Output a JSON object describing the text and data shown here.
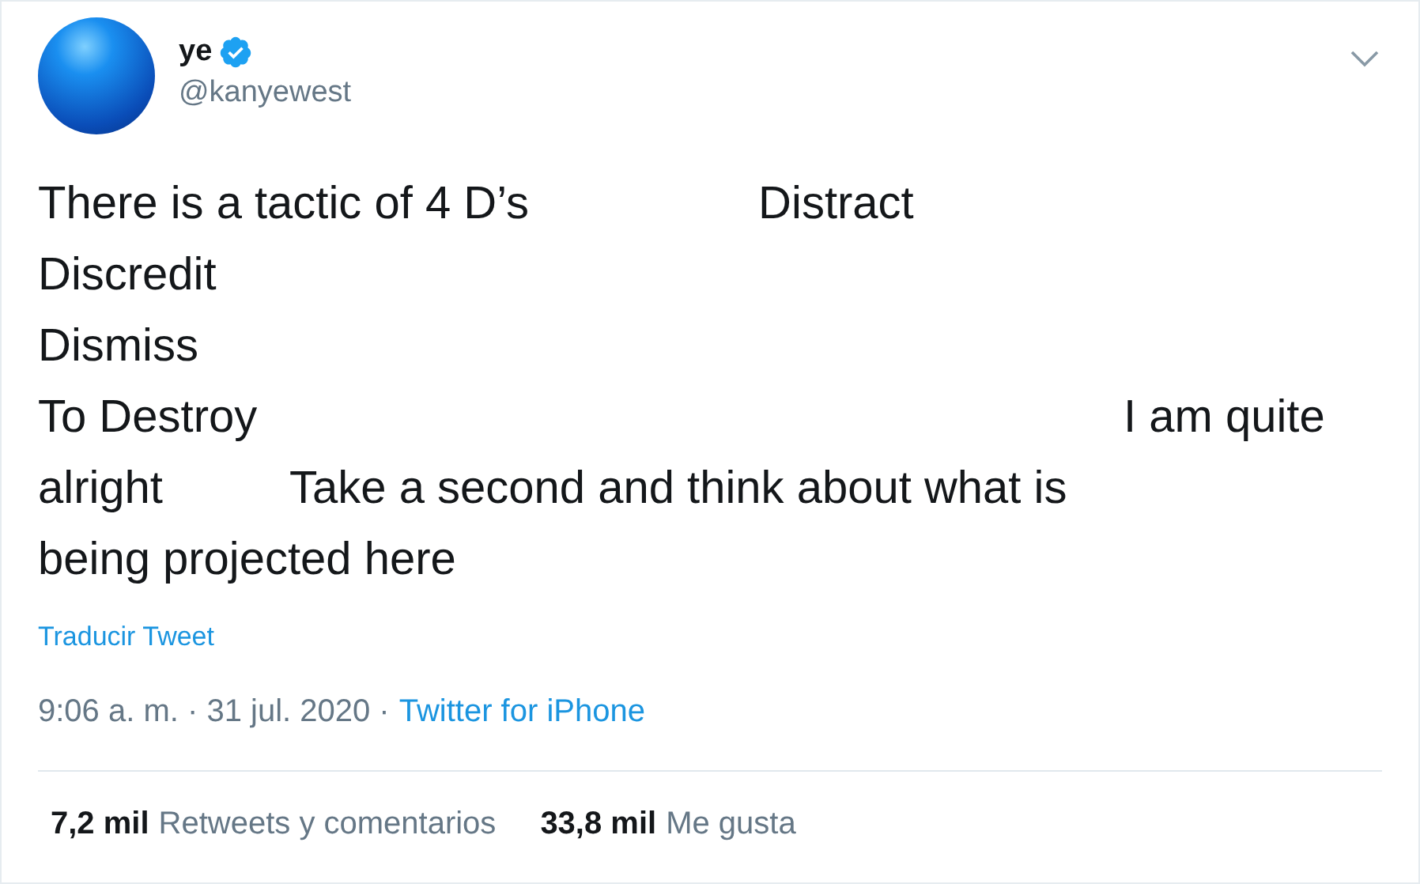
{
  "author": {
    "name": "ye",
    "verified": true,
    "handle": "@kanyewest"
  },
  "body_lines": [
    "There is a tactic of 4 D’s                  Distract",
    "Discredit",
    "Dismiss",
    "To Destroy                                                                    I am quite",
    "alright          Take a second and think about what is",
    "being projected here"
  ],
  "translate_link": "Traducir Tweet",
  "meta": {
    "timestamp": "9:06 a. m. · 31 jul. 2020 ·",
    "source": "Twitter for iPhone"
  },
  "stats": [
    {
      "count": "7,2 mil",
      "label": "Retweets y comentarios"
    },
    {
      "count": "33,8 mil",
      "label": "Me gusta"
    }
  ]
}
